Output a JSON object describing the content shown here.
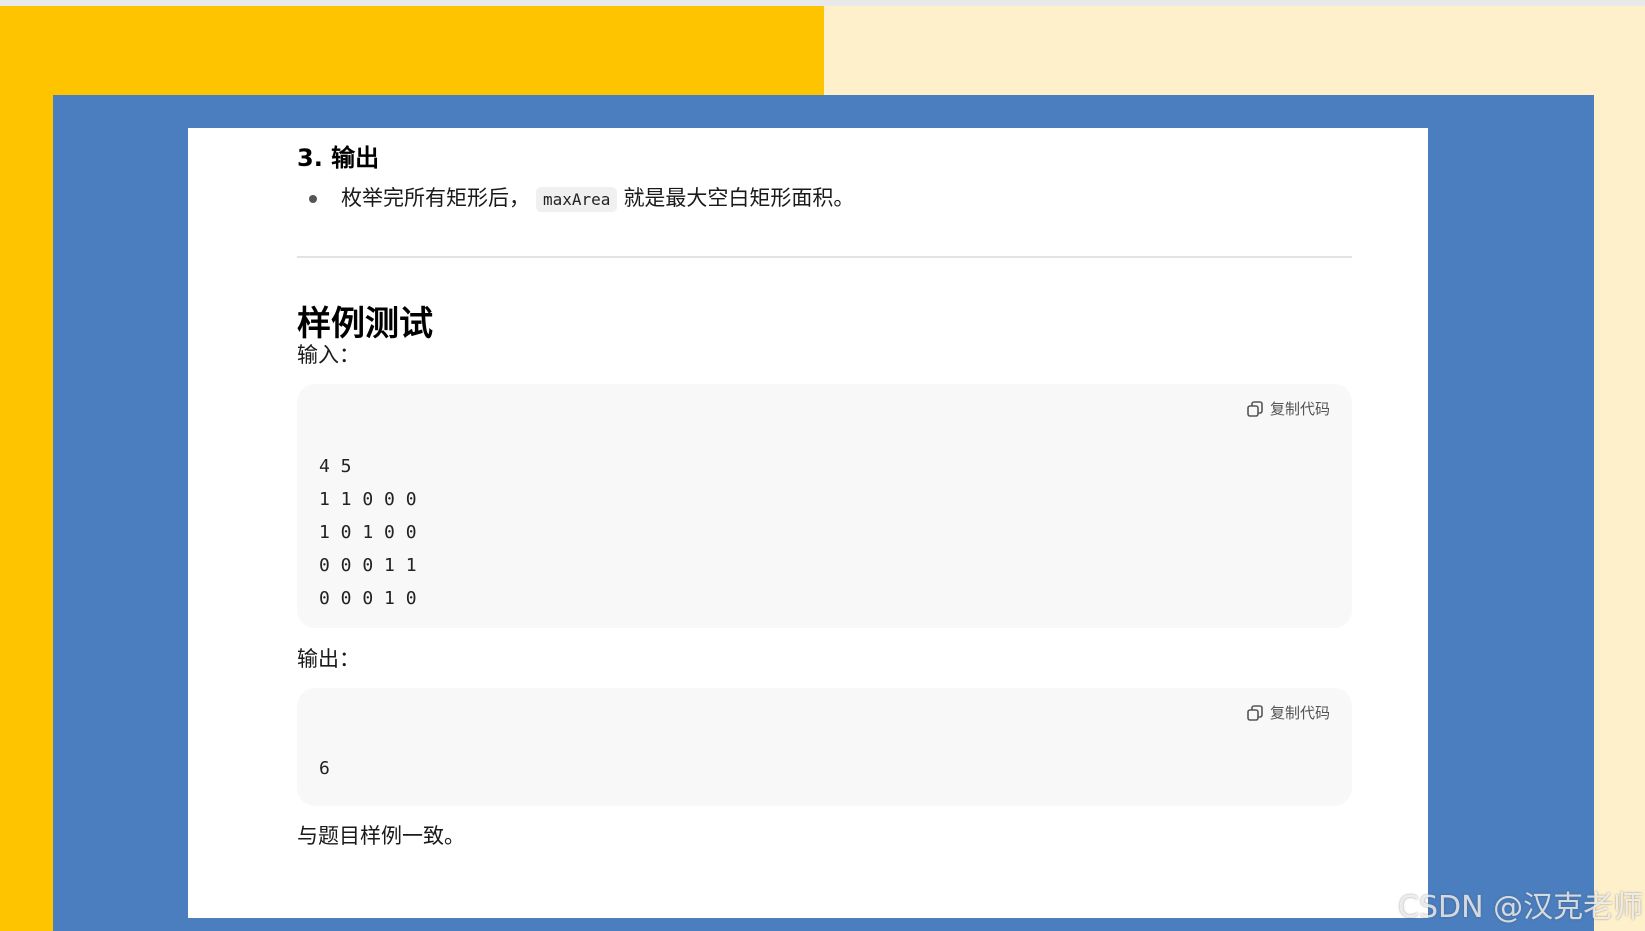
{
  "section_heading": "3. 输出",
  "bullet": {
    "before": "枚举完所有矩形后，",
    "code": "maxArea",
    "after": "就是最大空白矩形面积。"
  },
  "sample": {
    "title": "样例测试",
    "input_label": "输入：",
    "input_code": "4 5\n1 1 0 0 0\n1 0 1 0 0\n0 0 0 1 1\n0 0 0 1 0",
    "output_label": "输出：",
    "output_code": "6",
    "copy_label": "复制代码",
    "conclusion": "与题目样例一致。"
  },
  "watermark": "CSDN @汉克老师",
  "colors": {
    "left_background": "#ffc400",
    "right_background": "#fff0cc",
    "frame_blue": "#4a7ebe",
    "code_background": "#f8f8f8"
  }
}
